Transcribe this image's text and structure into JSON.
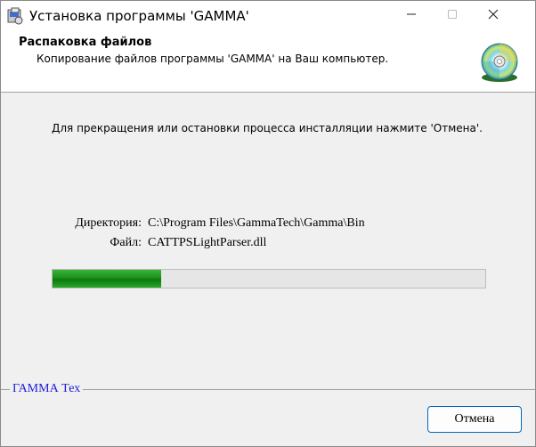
{
  "window": {
    "title": "Установка программы 'GAMMA'",
    "icons": {
      "app": "installer-icon",
      "minimize": "minimize-icon",
      "maximize": "maximize-icon",
      "close": "close-icon"
    }
  },
  "header": {
    "title": "Распаковка файлов",
    "subtitle": "Копирование файлов программы 'GAMMA' на Ваш компьютер.",
    "icon": "cd-disc-icon"
  },
  "main": {
    "message": "Для прекращения или остановки процесса инсталляции нажмите 'Отмена'.",
    "directory_label": "Директория:",
    "directory_value": "C:\\Program Files\\GammaTech\\Gamma\\Bin",
    "file_label": "Файл:",
    "file_value": "CATTPSLightParser.dll",
    "progress": 0.25
  },
  "footer": {
    "brand": "ГАММА Тех",
    "cancel_label": "Отмена"
  },
  "colors": {
    "progress_fill": "#1d8f1d",
    "brand_text": "#1b1bd8",
    "button_border": "#0067c0"
  }
}
